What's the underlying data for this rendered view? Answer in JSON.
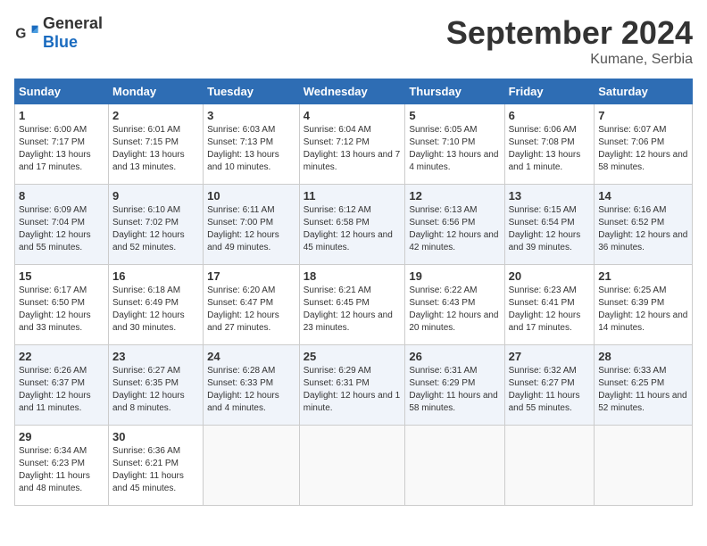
{
  "header": {
    "logo_general": "General",
    "logo_blue": "Blue",
    "month_title": "September 2024",
    "location": "Kumane, Serbia"
  },
  "calendar": {
    "weekdays": [
      "Sunday",
      "Monday",
      "Tuesday",
      "Wednesday",
      "Thursday",
      "Friday",
      "Saturday"
    ],
    "weeks": [
      [
        {
          "day": "1",
          "sunrise": "6:00 AM",
          "sunset": "7:17 PM",
          "daylight": "13 hours and 17 minutes."
        },
        {
          "day": "2",
          "sunrise": "6:01 AM",
          "sunset": "7:15 PM",
          "daylight": "13 hours and 13 minutes."
        },
        {
          "day": "3",
          "sunrise": "6:03 AM",
          "sunset": "7:13 PM",
          "daylight": "13 hours and 10 minutes."
        },
        {
          "day": "4",
          "sunrise": "6:04 AM",
          "sunset": "7:12 PM",
          "daylight": "13 hours and 7 minutes."
        },
        {
          "day": "5",
          "sunrise": "6:05 AM",
          "sunset": "7:10 PM",
          "daylight": "13 hours and 4 minutes."
        },
        {
          "day": "6",
          "sunrise": "6:06 AM",
          "sunset": "7:08 PM",
          "daylight": "13 hours and 1 minute."
        },
        {
          "day": "7",
          "sunrise": "6:07 AM",
          "sunset": "7:06 PM",
          "daylight": "12 hours and 58 minutes."
        }
      ],
      [
        {
          "day": "8",
          "sunrise": "6:09 AM",
          "sunset": "7:04 PM",
          "daylight": "12 hours and 55 minutes."
        },
        {
          "day": "9",
          "sunrise": "6:10 AM",
          "sunset": "7:02 PM",
          "daylight": "12 hours and 52 minutes."
        },
        {
          "day": "10",
          "sunrise": "6:11 AM",
          "sunset": "7:00 PM",
          "daylight": "12 hours and 49 minutes."
        },
        {
          "day": "11",
          "sunrise": "6:12 AM",
          "sunset": "6:58 PM",
          "daylight": "12 hours and 45 minutes."
        },
        {
          "day": "12",
          "sunrise": "6:13 AM",
          "sunset": "6:56 PM",
          "daylight": "12 hours and 42 minutes."
        },
        {
          "day": "13",
          "sunrise": "6:15 AM",
          "sunset": "6:54 PM",
          "daylight": "12 hours and 39 minutes."
        },
        {
          "day": "14",
          "sunrise": "6:16 AM",
          "sunset": "6:52 PM",
          "daylight": "12 hours and 36 minutes."
        }
      ],
      [
        {
          "day": "15",
          "sunrise": "6:17 AM",
          "sunset": "6:50 PM",
          "daylight": "12 hours and 33 minutes."
        },
        {
          "day": "16",
          "sunrise": "6:18 AM",
          "sunset": "6:49 PM",
          "daylight": "12 hours and 30 minutes."
        },
        {
          "day": "17",
          "sunrise": "6:20 AM",
          "sunset": "6:47 PM",
          "daylight": "12 hours and 27 minutes."
        },
        {
          "day": "18",
          "sunrise": "6:21 AM",
          "sunset": "6:45 PM",
          "daylight": "12 hours and 23 minutes."
        },
        {
          "day": "19",
          "sunrise": "6:22 AM",
          "sunset": "6:43 PM",
          "daylight": "12 hours and 20 minutes."
        },
        {
          "day": "20",
          "sunrise": "6:23 AM",
          "sunset": "6:41 PM",
          "daylight": "12 hours and 17 minutes."
        },
        {
          "day": "21",
          "sunrise": "6:25 AM",
          "sunset": "6:39 PM",
          "daylight": "12 hours and 14 minutes."
        }
      ],
      [
        {
          "day": "22",
          "sunrise": "6:26 AM",
          "sunset": "6:37 PM",
          "daylight": "12 hours and 11 minutes."
        },
        {
          "day": "23",
          "sunrise": "6:27 AM",
          "sunset": "6:35 PM",
          "daylight": "12 hours and 8 minutes."
        },
        {
          "day": "24",
          "sunrise": "6:28 AM",
          "sunset": "6:33 PM",
          "daylight": "12 hours and 4 minutes."
        },
        {
          "day": "25",
          "sunrise": "6:29 AM",
          "sunset": "6:31 PM",
          "daylight": "12 hours and 1 minute."
        },
        {
          "day": "26",
          "sunrise": "6:31 AM",
          "sunset": "6:29 PM",
          "daylight": "11 hours and 58 minutes."
        },
        {
          "day": "27",
          "sunrise": "6:32 AM",
          "sunset": "6:27 PM",
          "daylight": "11 hours and 55 minutes."
        },
        {
          "day": "28",
          "sunrise": "6:33 AM",
          "sunset": "6:25 PM",
          "daylight": "11 hours and 52 minutes."
        }
      ],
      [
        {
          "day": "29",
          "sunrise": "6:34 AM",
          "sunset": "6:23 PM",
          "daylight": "11 hours and 48 minutes."
        },
        {
          "day": "30",
          "sunrise": "6:36 AM",
          "sunset": "6:21 PM",
          "daylight": "11 hours and 45 minutes."
        },
        null,
        null,
        null,
        null,
        null
      ]
    ]
  }
}
